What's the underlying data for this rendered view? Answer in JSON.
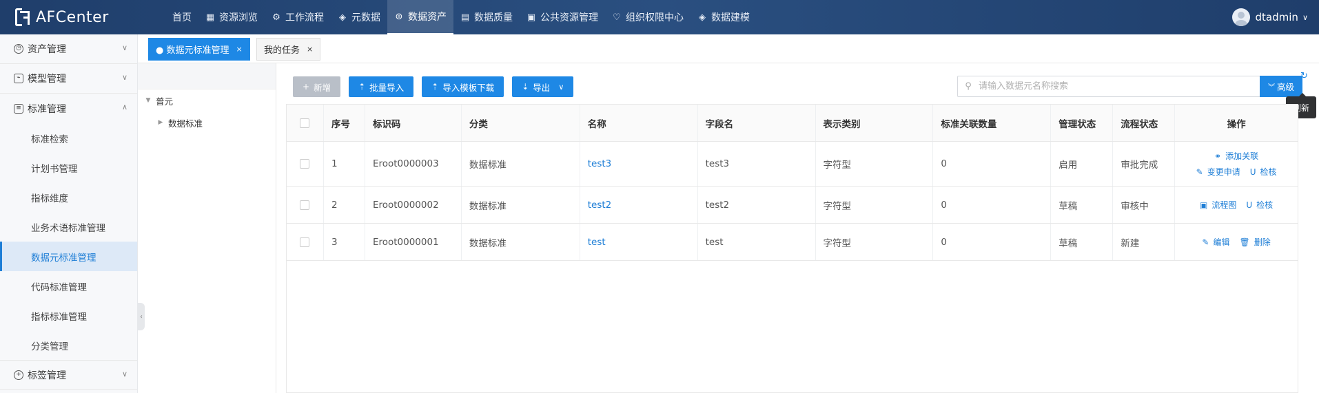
{
  "app": {
    "logo_text": "AFCenter"
  },
  "topnav": {
    "items": [
      {
        "label": "首页",
        "icon": ""
      },
      {
        "label": "资源浏览",
        "icon": "grid-icon"
      },
      {
        "label": "工作流程",
        "icon": "workflow-icon"
      },
      {
        "label": "元数据",
        "icon": "layers-icon"
      },
      {
        "label": "数据资产",
        "icon": "asset-icon"
      },
      {
        "label": "数据质量",
        "icon": "chart-icon"
      },
      {
        "label": "公共资源管理",
        "icon": "folder-icon"
      },
      {
        "label": "组织权限中心",
        "icon": "heart-shield-icon"
      },
      {
        "label": "数据建模",
        "icon": "stack-icon"
      }
    ],
    "active_index": 4
  },
  "user": {
    "name": "dtadmin"
  },
  "sidebar": {
    "groups": [
      {
        "label": "资产管理",
        "icon": "clock-icon",
        "expanded": false
      },
      {
        "label": "模型管理",
        "icon": "chart-icon",
        "expanded": false
      },
      {
        "label": "标准管理",
        "icon": "document-icon",
        "expanded": true
      },
      {
        "label": "标签管理",
        "icon": "plus-circle-icon",
        "expanded": false
      }
    ],
    "standard_items": [
      "标准检索",
      "计划书管理",
      "指标维度",
      "业务术语标准管理",
      "数据元标准管理",
      "代码标准管理",
      "指标标准管理",
      "分类管理"
    ],
    "active_item": "数据元标准管理"
  },
  "tabs": [
    {
      "label": "● 数据元标准管理",
      "active": true
    },
    {
      "label": "我的任务",
      "active": false
    }
  ],
  "tree": {
    "root": "普元",
    "children": [
      "数据标准"
    ]
  },
  "toolbar": {
    "add_label": "新增",
    "import_label": "批量导入",
    "template_label": "导入模板下载",
    "export_label": "导出"
  },
  "search": {
    "placeholder": "请输入数据元名称搜索",
    "advanced_label": "高级",
    "refresh_tooltip": "刷新"
  },
  "table": {
    "columns": [
      "序号",
      "标识码",
      "分类",
      "名称",
      "字段名",
      "表示类别",
      "标准关联数量",
      "管理状态",
      "流程状态",
      "操作"
    ],
    "rows": [
      {
        "no": "1",
        "code": "Eroot0000003",
        "category": "数据标准",
        "name": "test3",
        "field": "test3",
        "type": "字符型",
        "count": "0",
        "manage": "启用",
        "flow": "审批完成",
        "ops": {
          "line1": [
            "添加关联"
          ],
          "line2": [
            "变更申请",
            "检核"
          ]
        }
      },
      {
        "no": "2",
        "code": "Eroot0000002",
        "category": "数据标准",
        "name": "test2",
        "field": "test2",
        "type": "字符型",
        "count": "0",
        "manage": "草稿",
        "flow": "审核中",
        "ops": {
          "line1": [
            "流程图",
            "检核"
          ]
        }
      },
      {
        "no": "3",
        "code": "Eroot0000001",
        "category": "数据标准",
        "name": "test",
        "field": "test",
        "type": "字符型",
        "count": "0",
        "manage": "草稿",
        "flow": "新建",
        "ops": {
          "line1": [
            "编辑",
            "删除"
          ]
        }
      }
    ]
  },
  "colors": {
    "primary": "#1e88e5",
    "topbar": "#1f3e6b",
    "link": "#1e7ed6"
  }
}
